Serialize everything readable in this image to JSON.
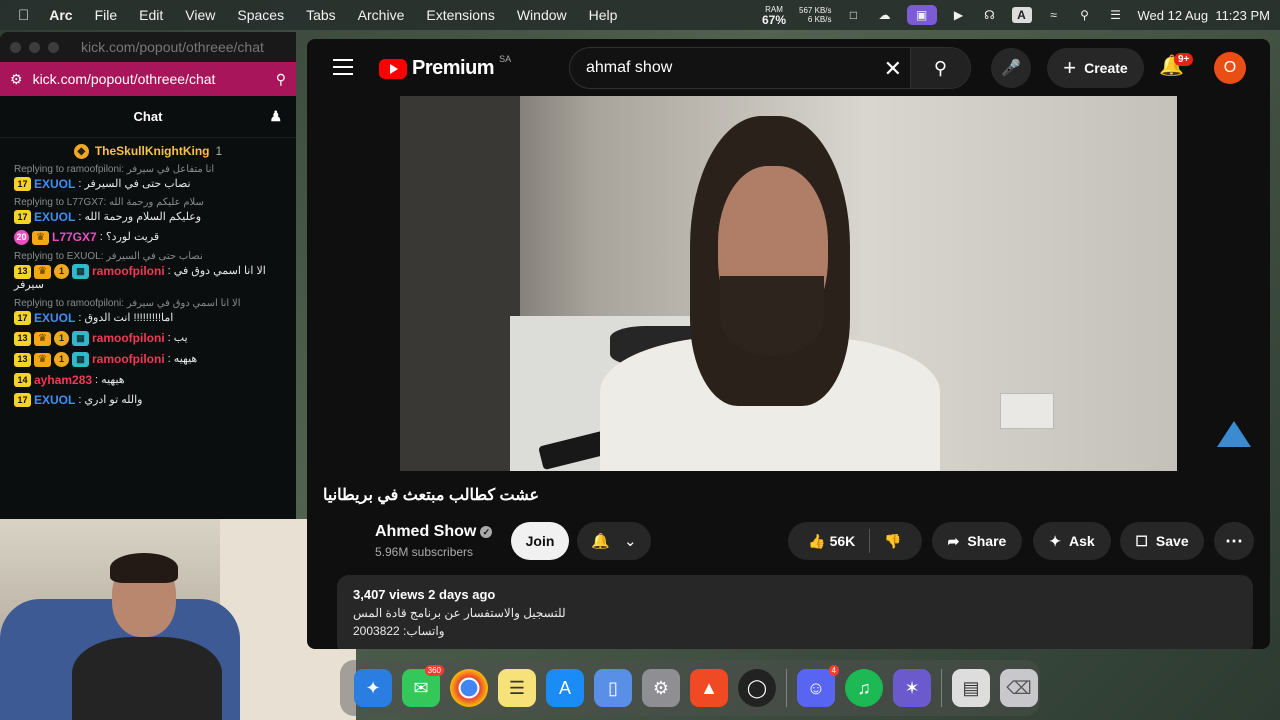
{
  "menubar": {
    "apple": "",
    "app": "Arc",
    "items": [
      "File",
      "Edit",
      "View",
      "Spaces",
      "Tabs",
      "Archive",
      "Extensions",
      "Window",
      "Help"
    ],
    "ram_label": "RAM",
    "ram_value": "67%",
    "net_up": "567 KB/s",
    "net_down": "6 KB/s",
    "keyboard": "A",
    "datetime": "Wed 12 Aug  11:23 PM"
  },
  "kick": {
    "title_url": "kick.com/popout/othreee/chat",
    "url": "kick.com/popout/othreee/chat",
    "chat_title": "Chat",
    "pinned_user": "TheSkullKnightKing",
    "pinned_count": "1",
    "messages": [
      {
        "reply": "Replying to ramoofpiloni: انا متفاعل في سيرفر",
        "level": "17",
        "user": "EXUOL",
        "color": "#3d8ff5",
        "text": ": نصاب حتى في السيرفر"
      },
      {
        "reply": "Replying to L77GX7: سلام عليكم ورحمة الله",
        "level": "17",
        "user": "EXUOL",
        "color": "#3d8ff5",
        "text": ": وعليكم السلام ورحمة الله"
      },
      {
        "reply": "",
        "level": "20",
        "user": "L77GX7",
        "color": "#e94fbf",
        "text": ": قريت لورد؟"
      },
      {
        "reply": "Replying to EXUOL: نصاب حتى في السيرفر",
        "level": "13",
        "user": "ramoofpiloni",
        "color": "#f13a55",
        "text": ": الا انا اسمي دوق في",
        "text2": "سيرفر"
      },
      {
        "reply": "Replying to ramoofpiloni: الا انا اسمي دوق في سيرفر",
        "level": "17",
        "user": "EXUOL",
        "color": "#3d8ff5",
        "text": ": اما!!!!!!!!! انت الدوق"
      },
      {
        "reply": "",
        "level": "13",
        "user": "ramoofpiloni",
        "color": "#f13a55",
        "text": ": يب"
      },
      {
        "reply": "",
        "level": "13",
        "user": "ramoofpiloni",
        "color": "#f13a55",
        "text": ": هيهيه"
      },
      {
        "reply": "",
        "level": "14",
        "user": "ayham283",
        "color": "#f13a55",
        "text": ": هيهيه"
      },
      {
        "reply": "",
        "level": "17",
        "user": "EXUOL",
        "color": "#3d8ff5",
        "text": ": والله تو ادري"
      }
    ]
  },
  "youtube": {
    "logo_word": "Premium",
    "region": "SA",
    "search_value": "ahmaf show",
    "create_label": "Create",
    "notif_count": "9+",
    "avatar_letter": "O",
    "video_title": "عشت كطالب مبتعث في بريطانيا",
    "channel_name": "Ahmed Show",
    "subscribers": "5.96M subscribers",
    "join_label": "Join",
    "likes": "56K",
    "share_label": "Share",
    "ask_label": "Ask",
    "save_label": "Save",
    "desc_meta": "3,407 views  2 days ago",
    "desc_line1": "للتسجيل والاستفسار عن برنامج قادة المس",
    "desc_line2": "واتساب: 2003822"
  },
  "dock": {
    "messages_badge": "360",
    "discord_badge": "4"
  }
}
